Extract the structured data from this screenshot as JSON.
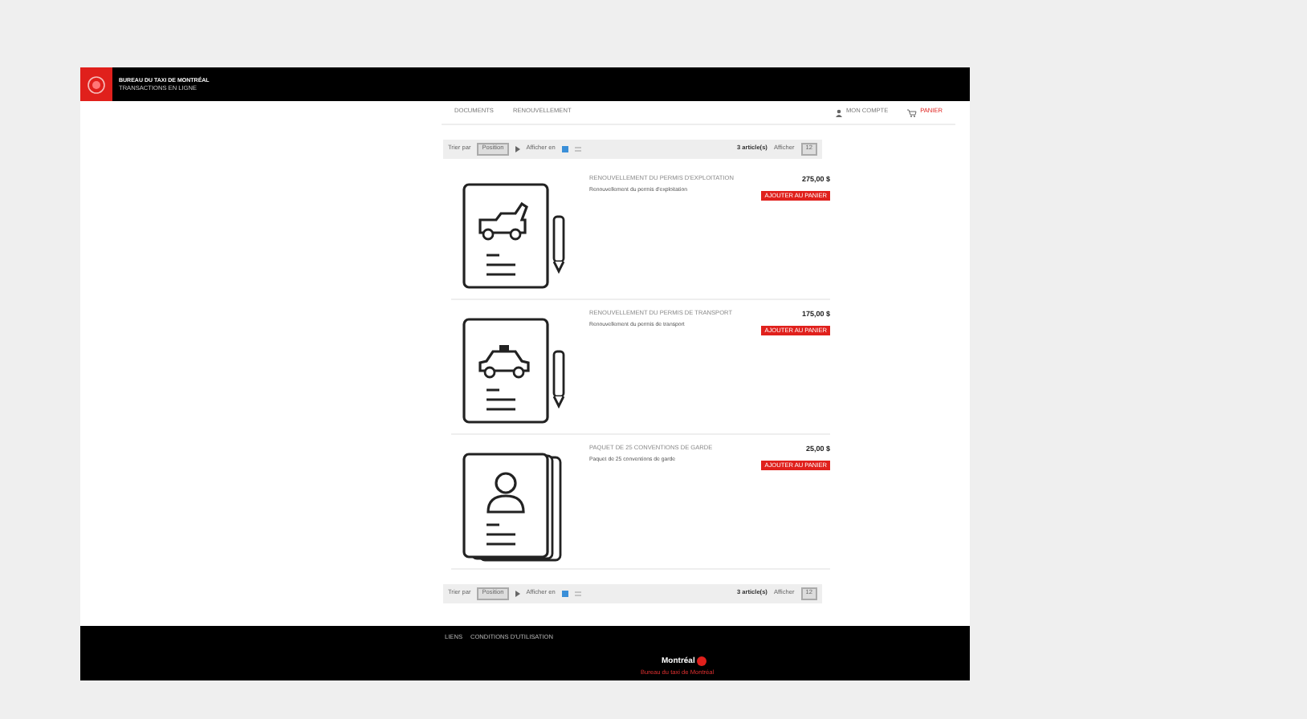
{
  "header": {
    "title": "BUREAU DU TAXI DE MONTRÉAL",
    "subtitle": "TRANSACTIONS EN LIGNE"
  },
  "nav": {
    "links": [
      {
        "label": "DOCUMENTS",
        "selected": false
      },
      {
        "label": "RENOUVELLEMENT",
        "selected": false
      }
    ],
    "account": "MON COMPTE",
    "cart": "PANIER"
  },
  "toolbars": [
    {
      "sort_label": "Trier par",
      "sort_value": "Position",
      "view_label": "Afficher en",
      "count": "3 article(s)",
      "show_label": "Afficher",
      "show_value": "12"
    },
    {
      "sort_label": "Trier par",
      "sort_value": "Position",
      "view_label": "Afficher en",
      "count": "3 article(s)",
      "show_label": "Afficher",
      "show_value": "12"
    }
  ],
  "products": [
    {
      "kind": "tow-truck",
      "title": "RENOUVELLEMENT DU PERMIS D'EXPLOITATION",
      "description": "Renouvellement du permis d'exploitation",
      "price": "275,00 $",
      "button": "AJOUTER AU PANIER"
    },
    {
      "kind": "taxi",
      "title": "RENOUVELLEMENT DU PERMIS DE TRANSPORT",
      "description": "Renouvellement du permis de transport",
      "price": "175,00 $",
      "button": "AJOUTER AU PANIER"
    },
    {
      "kind": "person",
      "title": "PAQUET DE 25 CONVENTIONS DE GARDE",
      "description": "Paquet de 25 conventions de garde",
      "price": "25,00 $",
      "button": "AJOUTER AU PANIER"
    }
  ],
  "footer": {
    "links": [
      "LIENS",
      "CONDITIONS D'UTILISATION"
    ],
    "logo": "Montréal",
    "tagline": "Bureau du taxi de Montréal"
  }
}
